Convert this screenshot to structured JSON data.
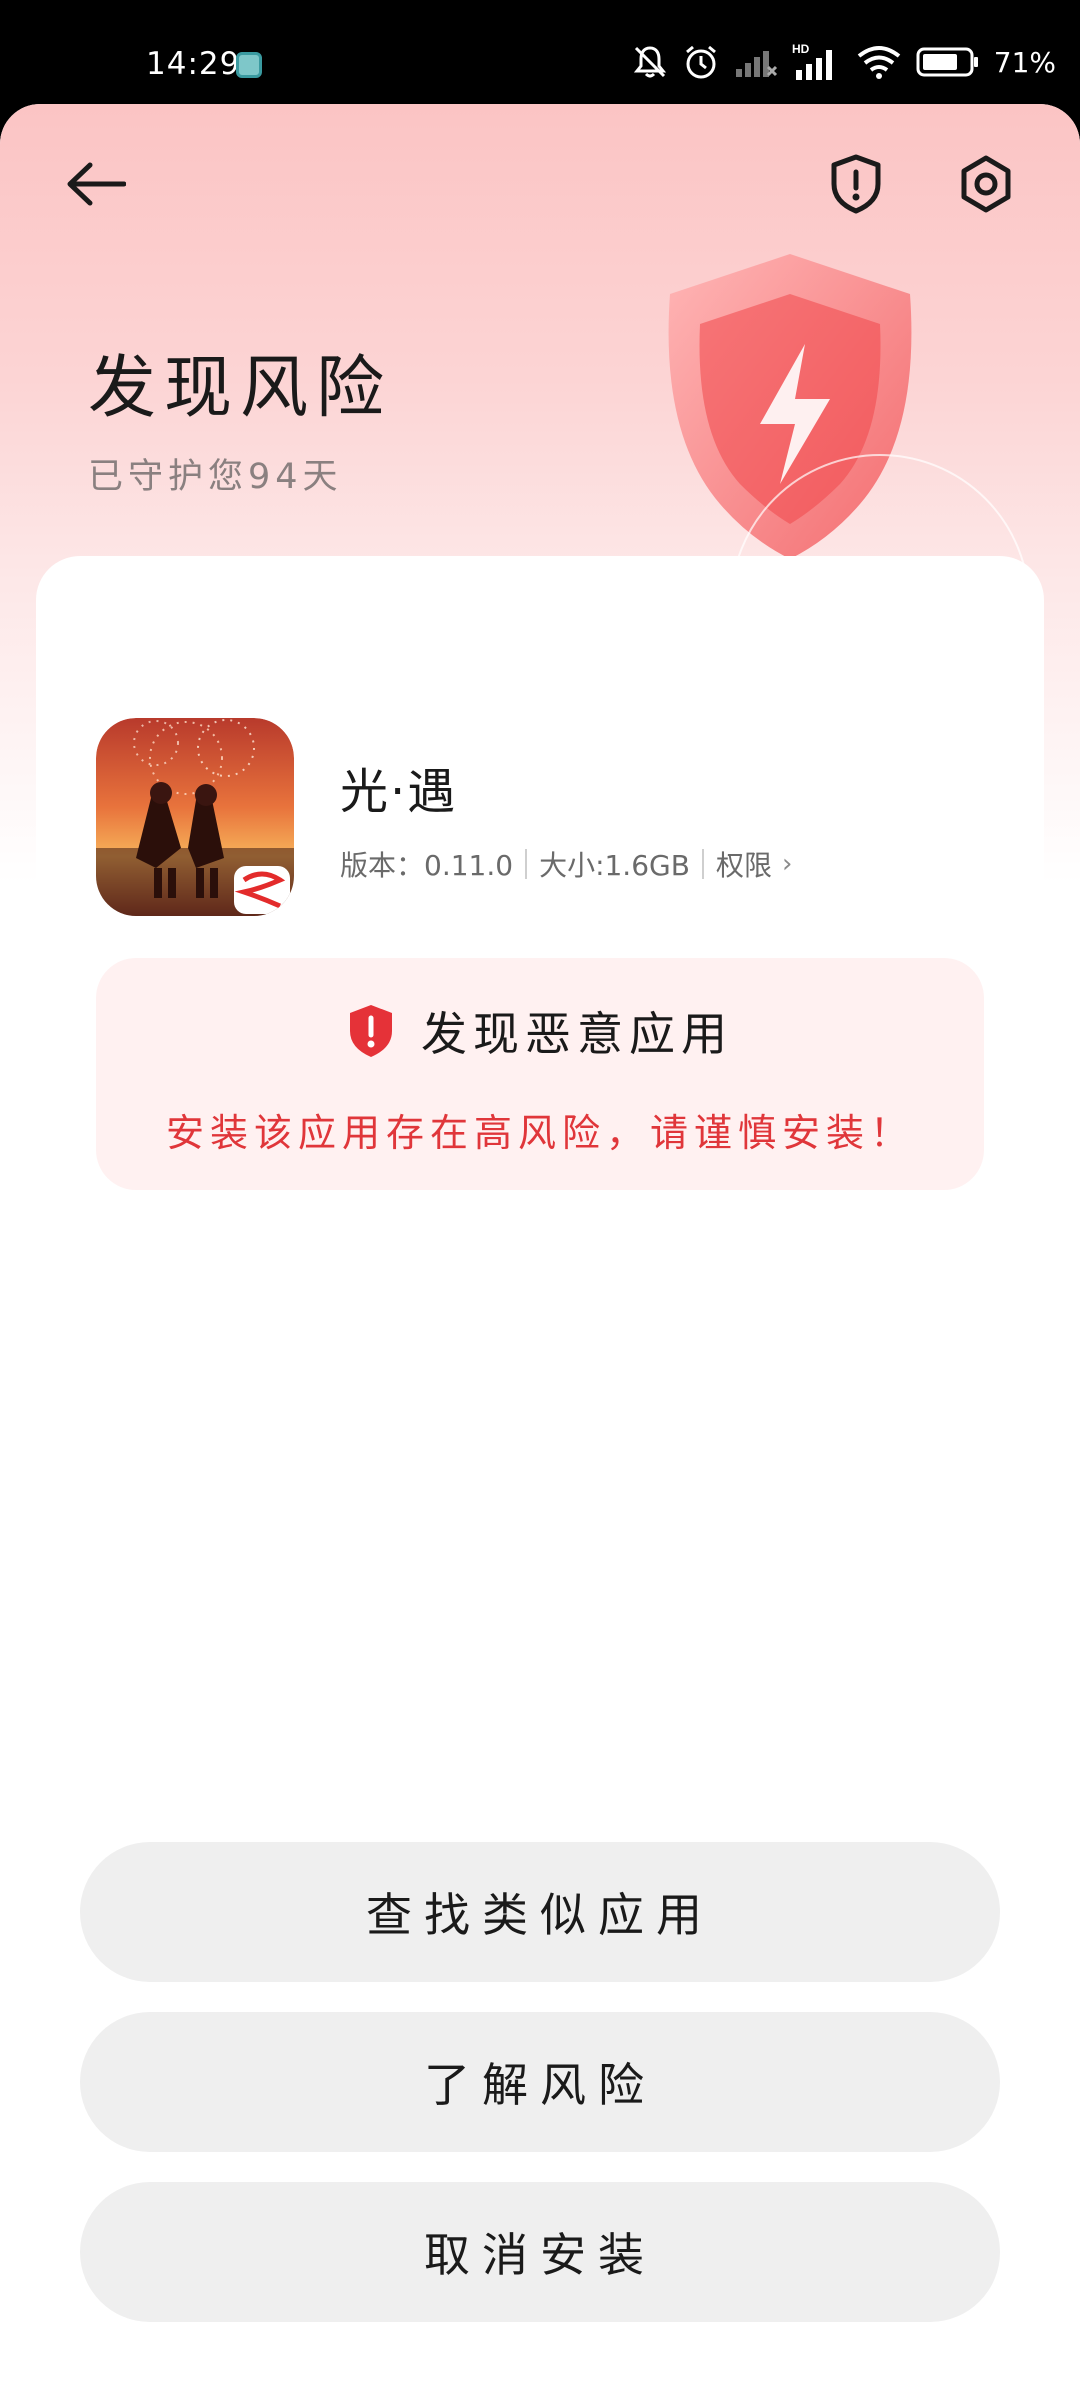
{
  "status_bar": {
    "time": "14:29",
    "battery": "71%",
    "icons": [
      "app-notification-icon",
      "mute-icon",
      "alarm-icon",
      "signal-off-icon",
      "hd-signal-icon",
      "wifi-icon",
      "battery-icon"
    ]
  },
  "header": {
    "title": "发现风险",
    "subtitle": "已守护您94天",
    "back_icon": "arrow-left-icon",
    "shield_icon": "shield-alert-icon",
    "settings_icon": "settings-gear-icon"
  },
  "app_info": {
    "name": "光·遇",
    "version": "版本：0.11.0",
    "size": "大小:1.6GB",
    "permissions": "权限",
    "permissions_chevron": "›"
  },
  "warning": {
    "title": "发现恶意应用",
    "message": "安装该应用存在高风险，请谨慎安装！",
    "accent_color": "#e0363a"
  },
  "actions": {
    "find_similar": "查找类似应用",
    "learn_risk": "了解风险",
    "cancel_install": "取消安装"
  }
}
